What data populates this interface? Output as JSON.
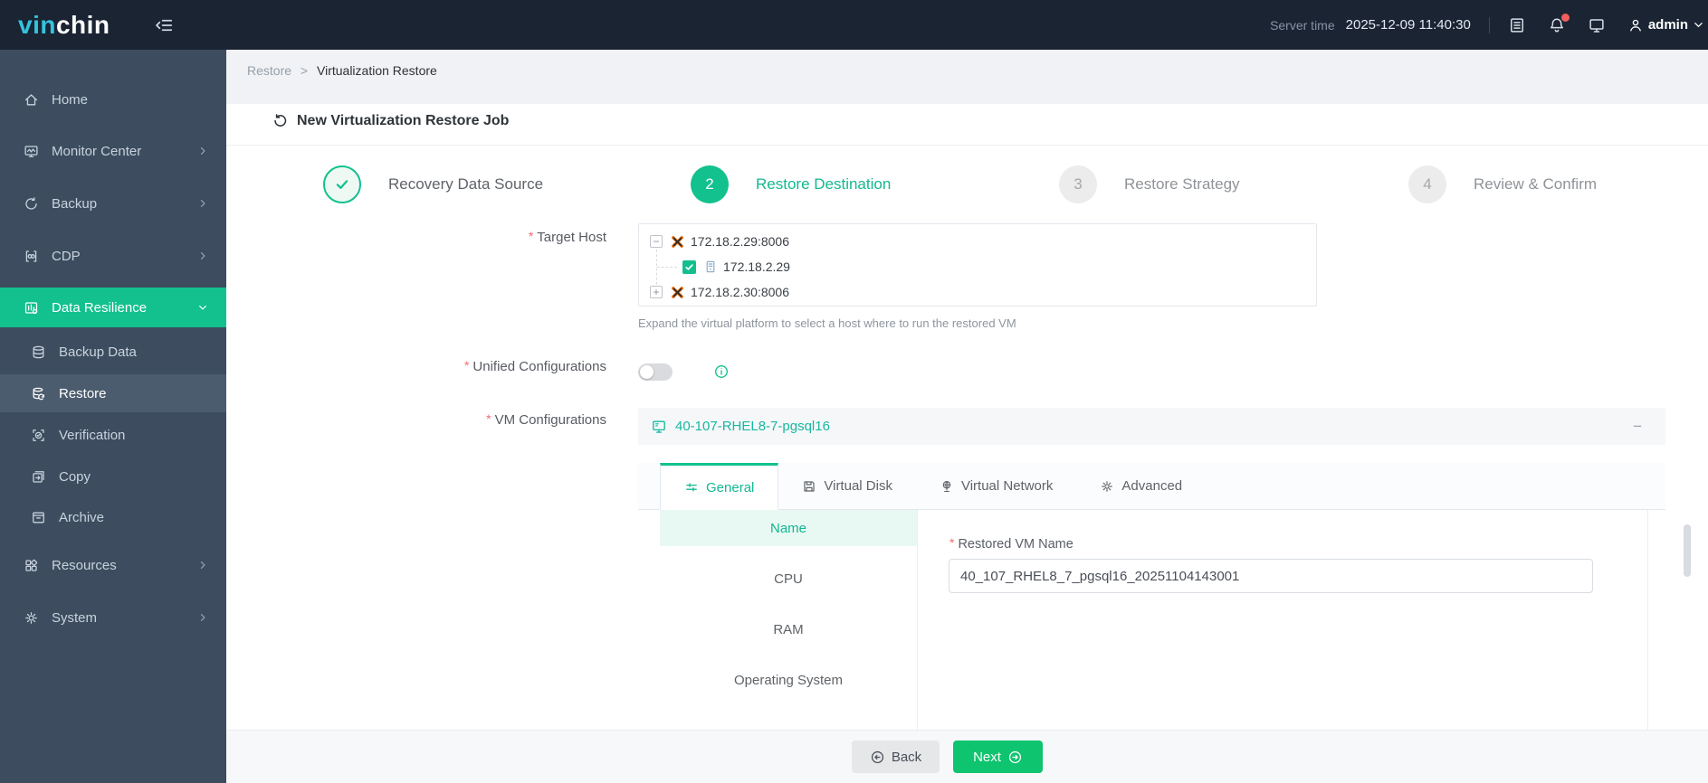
{
  "colors": {
    "topbar_bg": "#1a2433",
    "sidebar_bg": "#3d4d5f",
    "accent_green": "#12c18e",
    "accent_teal": "#17b8a0",
    "button_green": "#0fc46f",
    "required_red": "#f56c6c",
    "proxmox_orange": "#e56c0a",
    "notification_red": "#f25e5e"
  },
  "icons": {
    "fold-menu-icon": "hamburger with left arrow",
    "log-icon": "document list",
    "bell-icon": "bell with red dot",
    "monitor-icon": "display",
    "user-icon": "person silhouette",
    "restore-title-icon": "counterclockwise arrow",
    "proxmox-icon": "orange/black X platform logo",
    "host-icon": "server tower",
    "vm-icon": "virtual machine monitor",
    "info-icon": "circled i"
  },
  "topbar": {
    "logo_primary": "vin",
    "logo_secondary": "chin",
    "server_time_label": "Server time",
    "server_time_value": "2025-12-09 11:40:30",
    "username": "admin"
  },
  "sidebar": {
    "items": [
      {
        "label": "Home",
        "expandable": false
      },
      {
        "label": "Monitor Center",
        "expandable": true
      },
      {
        "label": "Backup",
        "expandable": true
      },
      {
        "label": "CDP",
        "expandable": true
      },
      {
        "label": "Data Resilience",
        "expandable": true,
        "expanded": true,
        "active": true
      },
      {
        "label": "Backup Data",
        "sub": true
      },
      {
        "label": "Restore",
        "sub": true,
        "active": true
      },
      {
        "label": "Verification",
        "sub": true,
        "expandable": true
      },
      {
        "label": "Copy",
        "sub": true
      },
      {
        "label": "Archive",
        "sub": true
      },
      {
        "label": "Resources",
        "expandable": true
      },
      {
        "label": "System",
        "expandable": true
      }
    ]
  },
  "breadcrumb": {
    "parent": "Restore",
    "separator": ">",
    "current": "Virtualization Restore"
  },
  "page": {
    "title": "New Virtualization Restore Job"
  },
  "steps": [
    {
      "number": "1",
      "label": "Recovery Data Source",
      "state": "done"
    },
    {
      "number": "2",
      "label": "Restore Destination",
      "state": "active"
    },
    {
      "number": "3",
      "label": "Restore Strategy",
      "state": "pending"
    },
    {
      "number": "4",
      "label": "Review & Confirm",
      "state": "pending"
    }
  ],
  "form": {
    "required_marker": "*",
    "target_host": {
      "label": "Target Host",
      "hint": "Expand the virtual platform to select a host where to run the restored VM",
      "nodes": [
        {
          "expander": "−",
          "name": "172.18.2.29:8006",
          "type": "platform"
        },
        {
          "checked": true,
          "name": "172.18.2.29",
          "type": "host"
        },
        {
          "expander": "+",
          "name": "172.18.2.30:8006",
          "type": "platform"
        }
      ]
    },
    "unified": {
      "label": "Unified Configurations",
      "enabled": false
    },
    "vm_config": {
      "label": "VM Configurations",
      "vm_name": "40-107-RHEL8-7-pgsql16",
      "collapse_glyph": "−",
      "tabs": [
        {
          "label": "General",
          "active": true
        },
        {
          "label": "Virtual Disk"
        },
        {
          "label": "Virtual Network"
        },
        {
          "label": "Advanced"
        }
      ],
      "settings_nav": [
        {
          "label": "Name",
          "active": true
        },
        {
          "label": "CPU"
        },
        {
          "label": "RAM"
        },
        {
          "label": "Operating System"
        }
      ],
      "fields": {
        "restored_vm_name": {
          "label": "Restored VM Name",
          "value": "40_107_RHEL8_7_pgsql16_20251104143001"
        }
      }
    }
  },
  "footer": {
    "back_label": "Back",
    "next_label": "Next"
  }
}
